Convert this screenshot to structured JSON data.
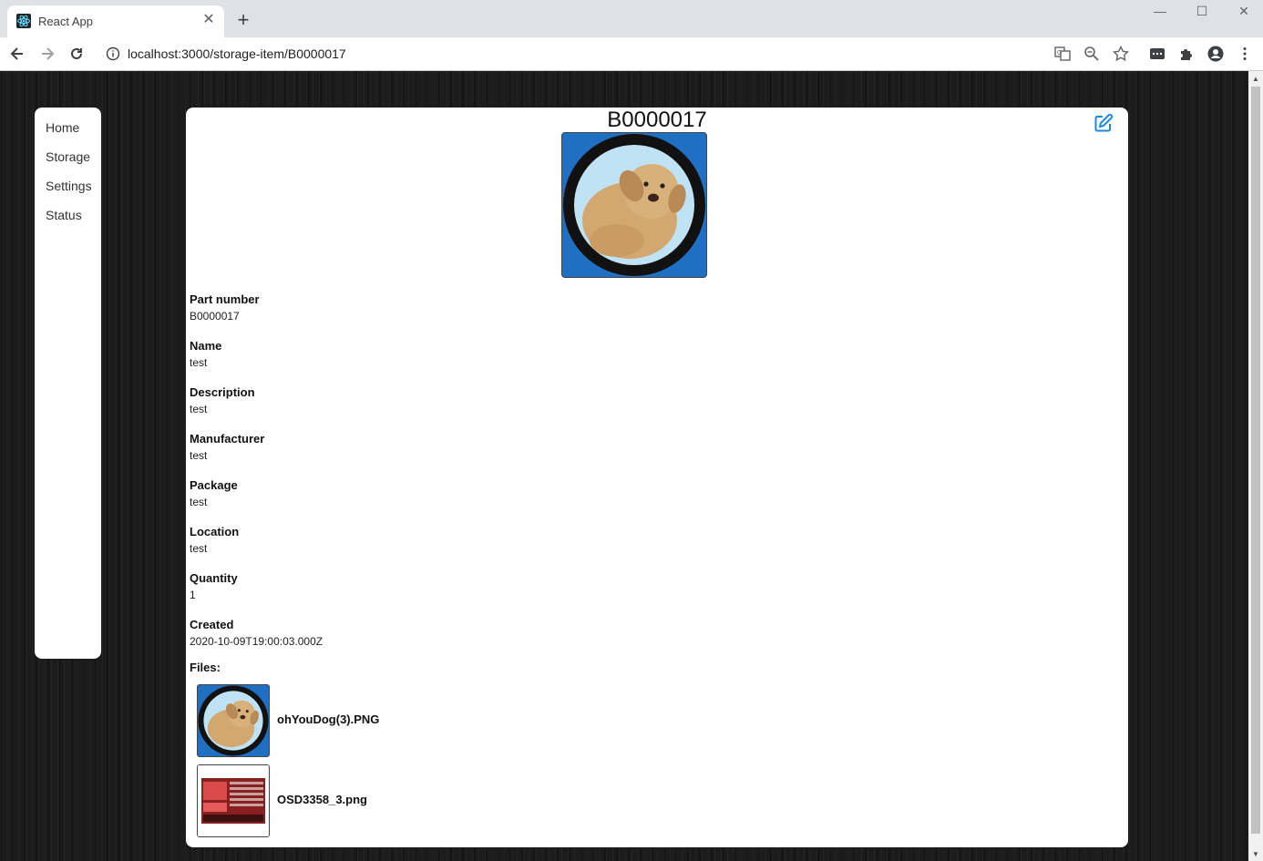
{
  "browser": {
    "tab_title": "React App",
    "url": "localhost:3000/storage-item/B0000017"
  },
  "sidebar": {
    "items": [
      {
        "label": "Home"
      },
      {
        "label": "Storage"
      },
      {
        "label": "Settings"
      },
      {
        "label": "Status"
      }
    ]
  },
  "item": {
    "title": "B0000017",
    "fields": [
      {
        "label": "Part number",
        "value": "B0000017"
      },
      {
        "label": "Name",
        "value": "test"
      },
      {
        "label": "Description",
        "value": "test"
      },
      {
        "label": "Manufacturer",
        "value": "test"
      },
      {
        "label": "Package",
        "value": "test"
      },
      {
        "label": "Location",
        "value": "test"
      },
      {
        "label": "Quantity",
        "value": "1"
      },
      {
        "label": "Created",
        "value": "2020-10-09T19:00:03.000Z"
      }
    ],
    "files_label": "Files:",
    "files": [
      {
        "name": "ohYouDog(3).PNG"
      },
      {
        "name": "OSD3358_3.png"
      }
    ]
  },
  "colors": {
    "accent": "#1e88e5",
    "page_background": "#1c1c1c"
  }
}
